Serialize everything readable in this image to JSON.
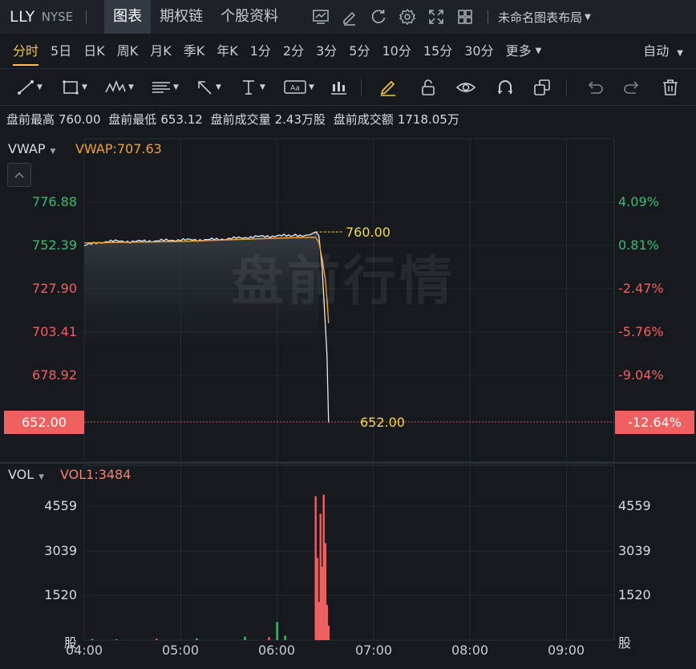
{
  "header": {
    "ticker": "LLY",
    "exchange": "NYSE",
    "tabs": [
      {
        "label": "图表",
        "active": true
      },
      {
        "label": "期权链",
        "active": false
      },
      {
        "label": "个股资料",
        "active": false
      }
    ],
    "icons": [
      "chart-compare-icon",
      "edit-icon",
      "refresh-icon",
      "settings-icon",
      "fullscreen-icon",
      "grid-layout-icon"
    ],
    "layout_label": "未命名图表布局"
  },
  "periods": {
    "items": [
      "分时",
      "5日",
      "日K",
      "周K",
      "月K",
      "季K",
      "年K",
      "1分",
      "2分",
      "3分",
      "5分",
      "10分",
      "15分",
      "30分"
    ],
    "active": "分时",
    "more_label": "更多",
    "auto_label": "自动"
  },
  "toolbar_icons": [
    "line-tool-icon",
    "rectangle-tool-icon",
    "wave-tool-icon",
    "fibonacci-tool-icon",
    "arrow-tool-icon",
    "text-tool-icon",
    "annotation-tool-icon",
    "bar-pattern-tool-icon",
    "pencil-icon",
    "unlock-icon",
    "eye-icon",
    "magnet-icon",
    "clone-icon",
    "undo-icon",
    "redo-icon",
    "trash-icon"
  ],
  "info": {
    "items": [
      {
        "label": "盘前最高",
        "value": "760.00"
      },
      {
        "label": "盘前最低",
        "value": "653.12"
      },
      {
        "label": "盘前成交量",
        "value": "2.43万股"
      },
      {
        "label": "盘前成交额",
        "value": "1718.05万"
      }
    ]
  },
  "price_panel": {
    "indicator_name": "VWAP",
    "indicator_value": "VWAP:707.63",
    "watermark": "盘前行情",
    "left_ticks": [
      "776.88",
      "752.39",
      "727.90",
      "703.41",
      "678.92"
    ],
    "right_ticks": [
      "4.09%",
      "0.81%",
      "-2.47%",
      "-5.76%",
      "-9.04%"
    ],
    "current_price": "652.00",
    "current_pct": "-12.64%",
    "high_annotation": "760.00",
    "low_annotation": "652.00"
  },
  "volume_panel": {
    "indicator_name": "VOL",
    "indicator_value": "VOL1:3484",
    "left_ticks": [
      "4559",
      "3039",
      "1520",
      "股"
    ],
    "right_ticks": [
      "4559",
      "3039",
      "1520",
      "股"
    ]
  },
  "x_axis": [
    "04:00",
    "05:00",
    "06:00",
    "07:00",
    "08:00",
    "09:00"
  ],
  "colors": {
    "up": "#3dbb6f",
    "down": "#ef6060",
    "vwap": "#f0a030",
    "highlight": "#f6c343",
    "annotation": "#f6d84a"
  },
  "chart_data": {
    "type": "line",
    "title": "",
    "xlabel": "",
    "ylabel": "",
    "ylim": [
      652,
      776.88
    ],
    "reference_price": 746.4,
    "x_range": [
      "04:00",
      "09:30"
    ],
    "series": [
      {
        "name": "",
        "x": [
          "04:00",
          "04:15",
          "04:30",
          "04:45",
          "05:00",
          "05:15",
          "05:30",
          "05:45",
          "06:00",
          "06:10",
          "06:20",
          "06:24",
          "06:26",
          "06:28",
          "06:30",
          "06:31",
          "06:32"
        ],
        "values": [
          752.5,
          754.8,
          754.6,
          755.0,
          755.5,
          755.5,
          756.2,
          757.2,
          757.8,
          758.0,
          758.3,
          760.0,
          758.0,
          740.0,
          707.0,
          690.0,
          652.0
        ]
      },
      {
        "name": "VWAP",
        "x": [
          "04:00",
          "05:00",
          "06:00",
          "06:24",
          "06:26",
          "06:28",
          "06:30",
          "06:31",
          "06:32"
        ],
        "values": [
          753.8,
          754.6,
          756.5,
          757.0,
          754.0,
          745.0,
          733.0,
          722.0,
          708.3
        ]
      }
    ],
    "volume": {
      "ylim": [
        0,
        4559
      ],
      "x": [
        "04:05",
        "04:20",
        "04:45",
        "05:10",
        "05:40",
        "05:55",
        "06:00",
        "06:05",
        "06:24",
        "06:25",
        "06:26",
        "06:27",
        "06:28",
        "06:29",
        "06:30",
        "06:31",
        "06:32"
      ],
      "values": [
        40,
        30,
        50,
        60,
        120,
        100,
        620,
        150,
        4900,
        2800,
        1300,
        4300,
        2500,
        4950,
        3300,
        1200,
        500
      ],
      "colors": [
        "up",
        "up",
        "down",
        "up",
        "up",
        "down",
        "up",
        "up",
        "down",
        "down",
        "down",
        "down",
        "down",
        "down",
        "down",
        "down",
        "down"
      ]
    }
  }
}
